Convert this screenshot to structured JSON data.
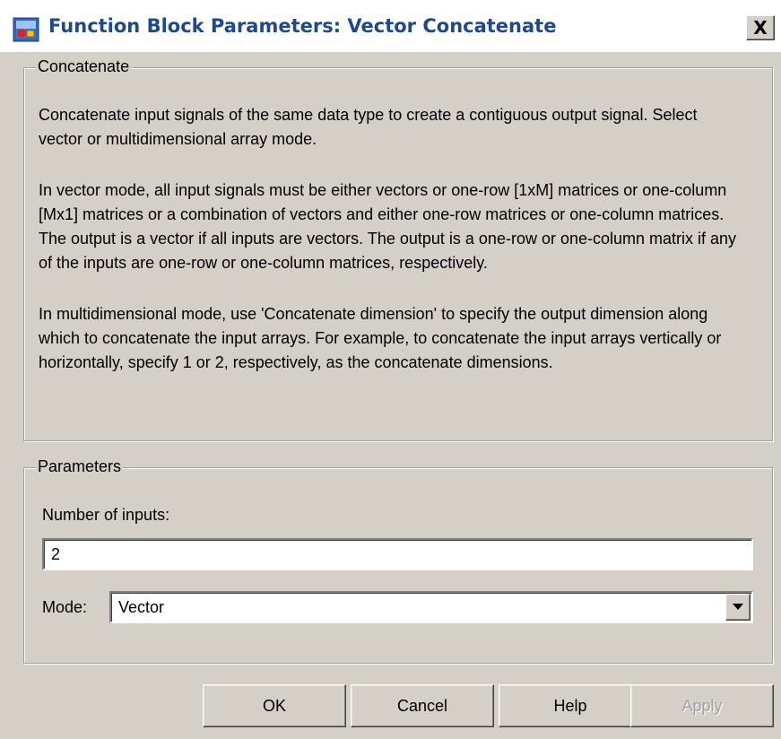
{
  "window": {
    "title": "Function Block Parameters: Vector Concatenate",
    "close_label": "X"
  },
  "concatenate_group": {
    "legend": "Concatenate",
    "paragraphs": [
      "Concatenate input signals of the same data type to create a contiguous output signal. Select vector or multidimensional array mode.",
      "In vector mode, all input signals must be either vectors or one-row [1xM] matrices or one-column [Mx1] matrices or a combination of vectors and either one-row matrices or one-column matrices. The output is a vector if all inputs are vectors. The output is a one-row or one-column matrix if any of the inputs are one-row or one-column matrices, respectively.",
      "In multidimensional mode, use 'Concatenate dimension' to specify the output dimension along which to concatenate the input arrays. For example, to concatenate the input arrays vertically or horizontally, specify 1 or 2, respectively, as the concatenate dimensions."
    ]
  },
  "parameters_group": {
    "legend": "Parameters",
    "number_of_inputs_label": "Number of inputs:",
    "number_of_inputs_value": "2",
    "mode_label": "Mode:",
    "mode_value": "Vector"
  },
  "buttons": {
    "ok": "OK",
    "cancel": "Cancel",
    "help": "Help",
    "apply": "Apply"
  },
  "icons": {
    "app": "simulink-block-icon",
    "dropdown": "chevron-down-icon"
  }
}
